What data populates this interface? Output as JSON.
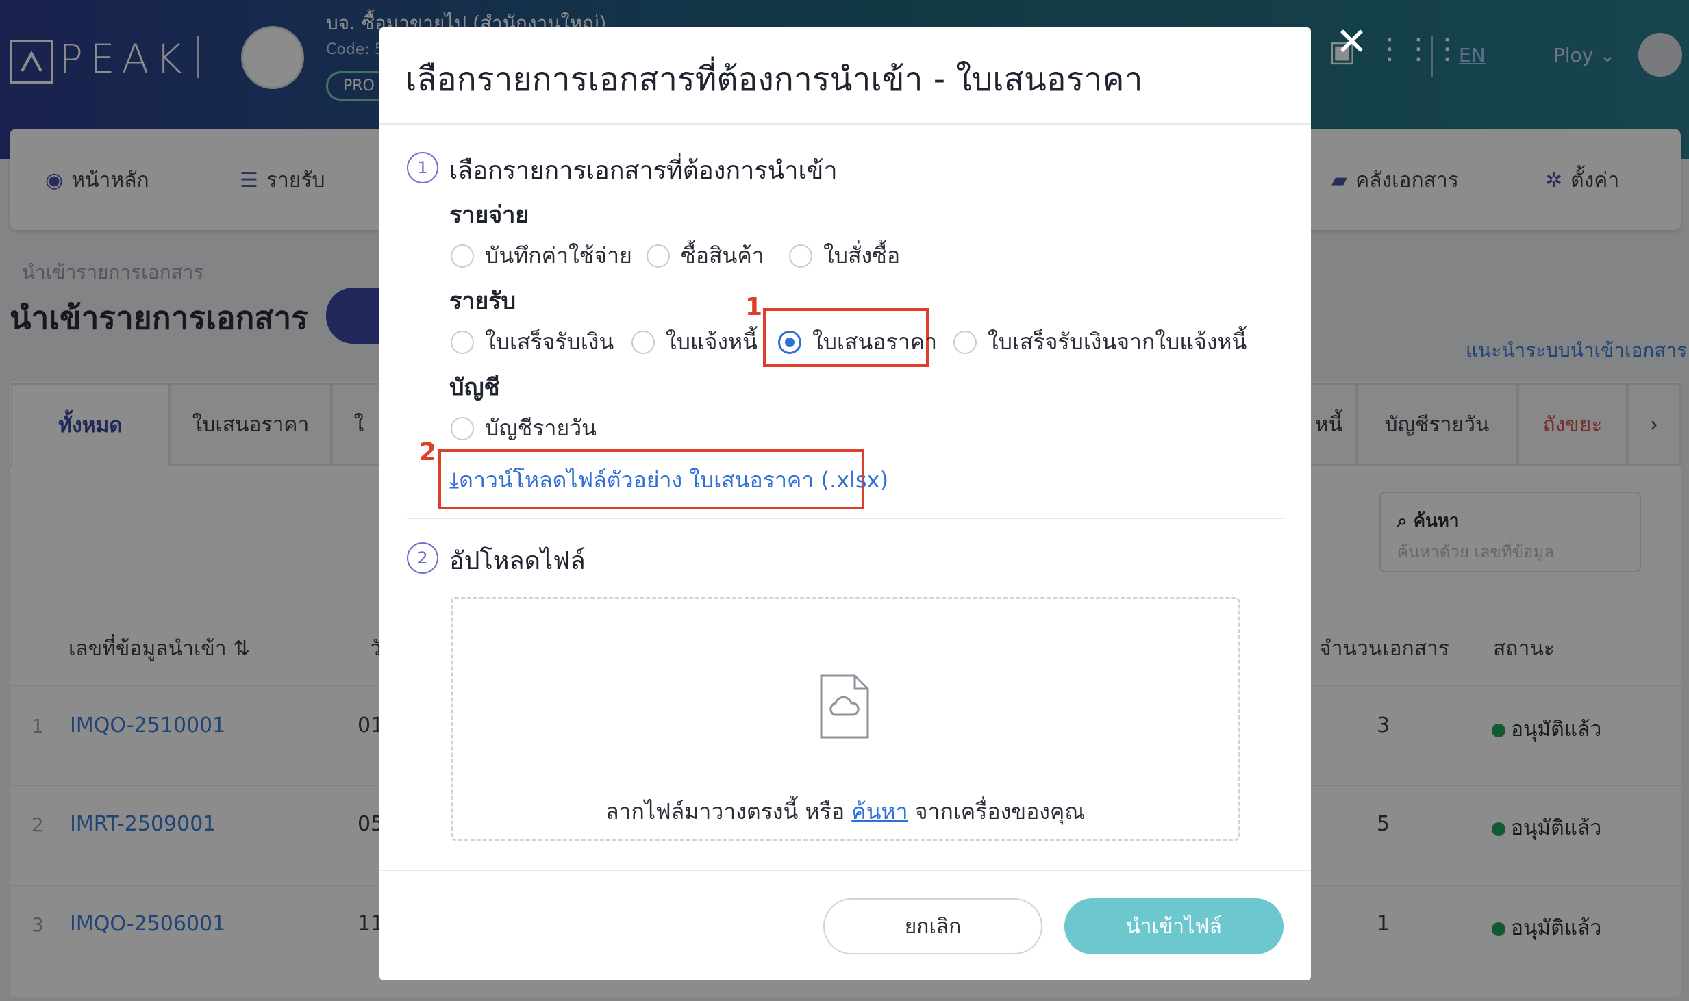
{
  "header": {
    "logo": "PEAK",
    "company_name": "บจ. ซื้อมาขายไป (สำนักงานใหญ่)",
    "company_code": "Code: 5",
    "plan": "PRO",
    "language": "EN",
    "user": "Ploy"
  },
  "nav": {
    "home": "หน้าหลัก",
    "income": "รายรับ",
    "documents": "คลังเอกสาร",
    "settings": "ตั้งค่า"
  },
  "page": {
    "breadcrumb": "นำเข้ารายการเอกสาร",
    "title": "นำเข้ารายการเอกสาร",
    "guide_link": "แนะนำระบบนำเข้าเอกสาร"
  },
  "tabs": [
    {
      "label": "ทั้งหมด"
    },
    {
      "label": "ใบเสนอราคา"
    },
    {
      "label": "ใ"
    },
    {
      "label": "หนี้"
    },
    {
      "label": "บัญชีรายวัน"
    },
    {
      "label": "ถังขยะ"
    }
  ],
  "search": {
    "label": "ค้นหา",
    "placeholder": "ค้นหาด้วย เลขที่ข้อมูล"
  },
  "table": {
    "headers": {
      "id": "เลขที่ข้อมูลนำเข้า",
      "col2": "วั",
      "count": "จำนวนเอกสาร",
      "status": "สถานะ"
    },
    "rows": [
      {
        "no": "1",
        "id": "IMQO-2510001",
        "date": "01",
        "count": "3",
        "status": "อนุมัติแล้ว"
      },
      {
        "no": "2",
        "id": "IMRT-2509001",
        "date": "05",
        "count": "5",
        "status": "อนุมัติแล้ว"
      },
      {
        "no": "3",
        "id": "IMQO-2506001",
        "date": "11",
        "count": "1",
        "status": "อนุมัติแล้ว"
      }
    ]
  },
  "modal": {
    "title": "เลือกรายการเอกสารที่ต้องการนำเข้า - ใบเสนอราคา",
    "step1": {
      "num": "1",
      "title": "เลือกรายการเอกสารที่ต้องการนำเข้า"
    },
    "groups": {
      "expense": {
        "label": "รายจ่าย",
        "options": [
          "บันทึกค่าใช้จ่าย",
          "ซื้อสินค้า",
          "ใบสั่งซื้อ"
        ]
      },
      "income": {
        "label": "รายรับ",
        "options": [
          "ใบเสร็จรับเงิน",
          "ใบแจ้งหนี้",
          "ใบเสนอราคา",
          "ใบเสร็จรับเงินจากใบแจ้งหนี้"
        ],
        "selected": "ใบเสนอราคา"
      },
      "account": {
        "label": "บัญชี",
        "options": [
          "บัญชีรายวัน"
        ]
      }
    },
    "annotations": {
      "one": "1",
      "two": "2"
    },
    "download_link": "ดาวน์โหลดไฟล์ตัวอย่าง ใบเสนอราคา (.xlsx)",
    "step2": {
      "num": "2",
      "title": "อัปโหลดไฟล์"
    },
    "dropzone": {
      "prefix": "ลากไฟล์มาวางตรงนี้ หรือ ",
      "link": "ค้นหา",
      "suffix": " จากเครื่องของคุณ"
    },
    "cancel": "ยกเลิก",
    "import": "นำเข้าไฟล์"
  }
}
